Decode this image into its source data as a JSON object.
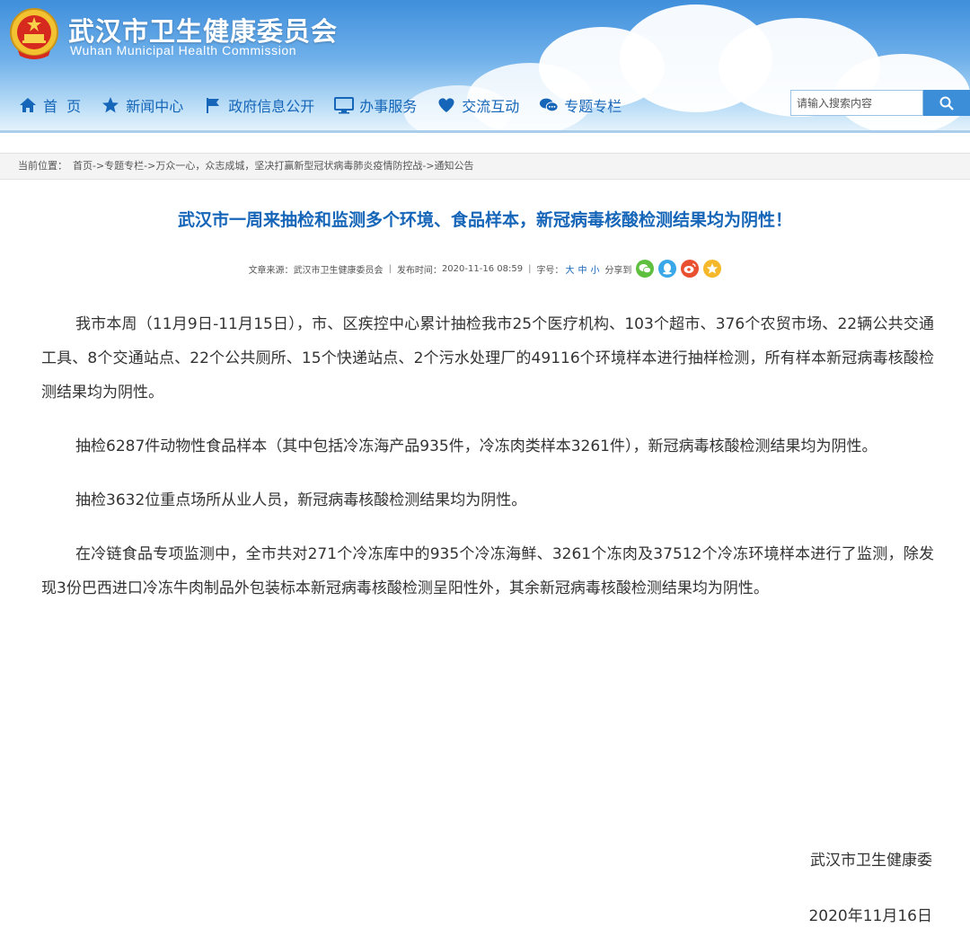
{
  "header": {
    "title_cn": "武汉市卫生健康委员会",
    "title_en": "Wuhan Municipal Health Commission",
    "emblem_icon": "national-emblem-icon"
  },
  "nav": {
    "items": [
      {
        "label": "首  页",
        "icon": "home-icon"
      },
      {
        "label": "新闻中心",
        "icon": "star-icon"
      },
      {
        "label": "政府信息公开",
        "icon": "flag-icon"
      },
      {
        "label": "办事服务",
        "icon": "monitor-icon"
      },
      {
        "label": "交流互动",
        "icon": "heart-icon"
      },
      {
        "label": "专题专栏",
        "icon": "chat-icon"
      }
    ],
    "color": "#1565b8"
  },
  "search": {
    "placeholder": "请输入搜索内容",
    "button_icon": "search-icon"
  },
  "breadcrumb": {
    "label": "当前位置：",
    "path": "首页->专题专栏->万众一心，众志成城，坚决打赢新型冠状病毒肺炎疫情防控战->通知公告"
  },
  "article": {
    "title": "武汉市一周来抽检和监测多个环境、食品样本，新冠病毒核酸检测结果均为阴性！",
    "meta": {
      "source_label": "文章来源：",
      "source": "武汉市卫生健康委员会",
      "date_label": "发布时间：",
      "date": "2020-11-16 08:59",
      "font_size_label": "字号：",
      "font_large": "大",
      "font_medium": "中",
      "font_small": "小",
      "share_label": "分享到"
    },
    "share_icons": [
      "wechat-icon",
      "qq-icon",
      "weibo-icon",
      "qzone-icon"
    ],
    "paragraphs": [
      "我市本周（11月9日-11月15日），市、区疾控中心累计抽检我市25个医疗机构、103个超市、376个农贸市场、22辆公共交通工具、8个交通站点、22个公共厕所、15个快递站点、2个污水处理厂的49116个环境样本进行抽样检测，所有样本新冠病毒核酸检测结果均为阴性。",
      "抽检6287件动物性食品样本（其中包括冷冻海产品935件，冷冻肉类样本3261件），新冠病毒核酸检测结果均为阴性。",
      "抽检3632位重点场所从业人员，新冠病毒核酸检测结果均为阴性。",
      "在冷链食品专项监测中，全市共对271个冷冻库中的935个冷冻海鲜、3261个冻肉及37512个冷冻环境样本进行了监测，除发现3份巴西进口冷冻牛肉制品外包装标本新冠病毒核酸检测呈阳性外，其余新冠病毒核酸检测结果均为阴性。"
    ],
    "signature": "武汉市卫生健康委",
    "sign_date": "2020年11月16日"
  }
}
